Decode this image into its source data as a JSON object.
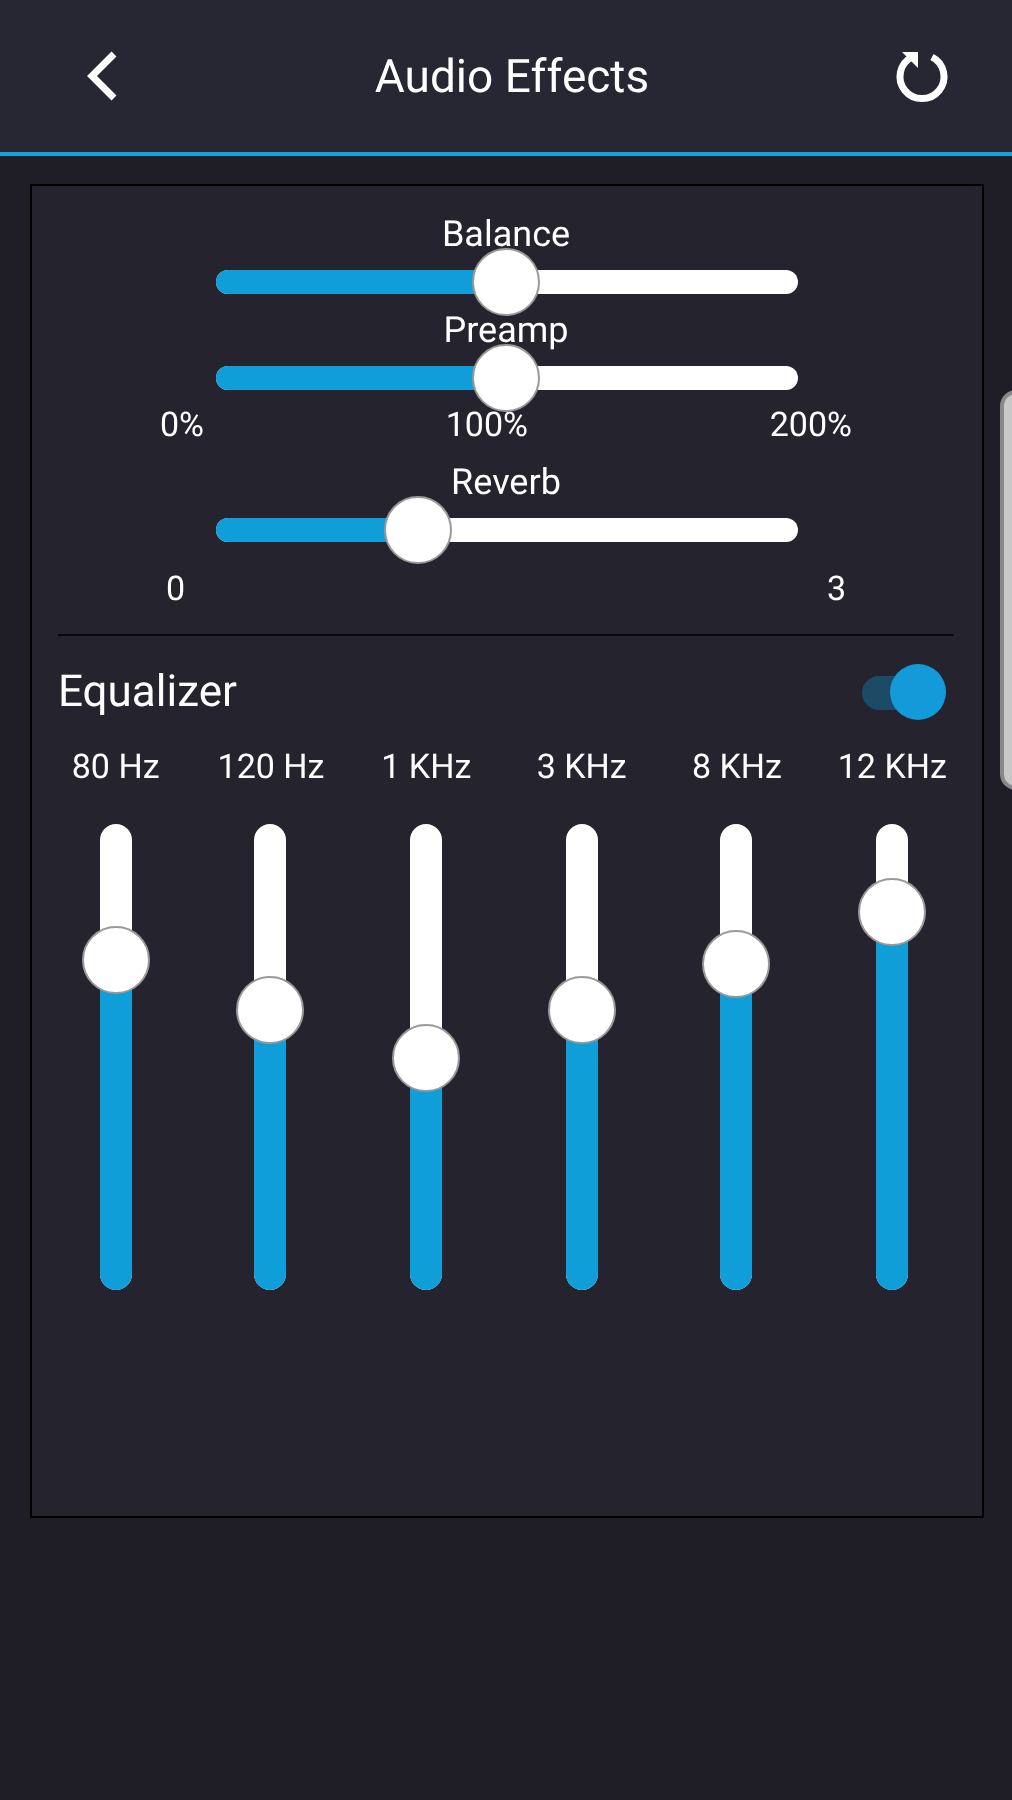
{
  "header": {
    "title": "Audio Effects"
  },
  "sliders": [
    {
      "label": "Balance",
      "level": 0.5
    },
    {
      "label": "Preamp",
      "level": 0.5,
      "scale": [
        "0%",
        "100%",
        "200%"
      ]
    },
    {
      "label": "Reverb",
      "level": 0.35,
      "ends": [
        "0",
        "3"
      ]
    }
  ],
  "equalizer": {
    "title": "Equalizer",
    "on": true,
    "bands": [
      {
        "label": "80 Hz",
        "level": 0.71
      },
      {
        "label": "120 Hz",
        "level": 0.6
      },
      {
        "label": "1 KHz",
        "level": 0.5
      },
      {
        "label": "3 KHz",
        "level": 0.6
      },
      {
        "label": "8 KHz",
        "level": 0.7
      },
      {
        "label": "12 KHz",
        "level": 0.81
      }
    ]
  }
}
